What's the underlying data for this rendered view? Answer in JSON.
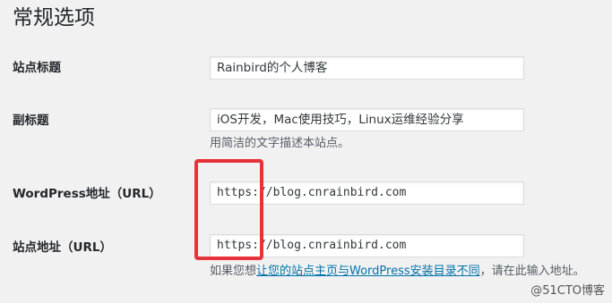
{
  "page": {
    "title": "常规选项"
  },
  "settings": {
    "site_title": {
      "label": "站点标题",
      "value": "Rainbird的个人博客"
    },
    "tagline": {
      "label": "副标题",
      "value": "iOS开发，Mac使用技巧，Linux运维经验分享",
      "description": "用简洁的文字描述本站点。"
    },
    "wordpress_address": {
      "label": "WordPress地址（URL）",
      "value": "https://blog.cnrainbird.com"
    },
    "site_address": {
      "label": "站点地址（URL）",
      "value": "https://blog.cnrainbird.com",
      "description_prefix": "如果您想",
      "description_link": "让您的站点主页与WordPress安装目录不同",
      "description_suffix": "，请在此输入地址。"
    }
  },
  "annotation": {
    "highlight_color": "#e8323a"
  },
  "watermark": {
    "text": "@51CTO博客"
  },
  "colors": {
    "background": "#f1f1f1",
    "link": "#0073aa",
    "text": "#23282d"
  }
}
